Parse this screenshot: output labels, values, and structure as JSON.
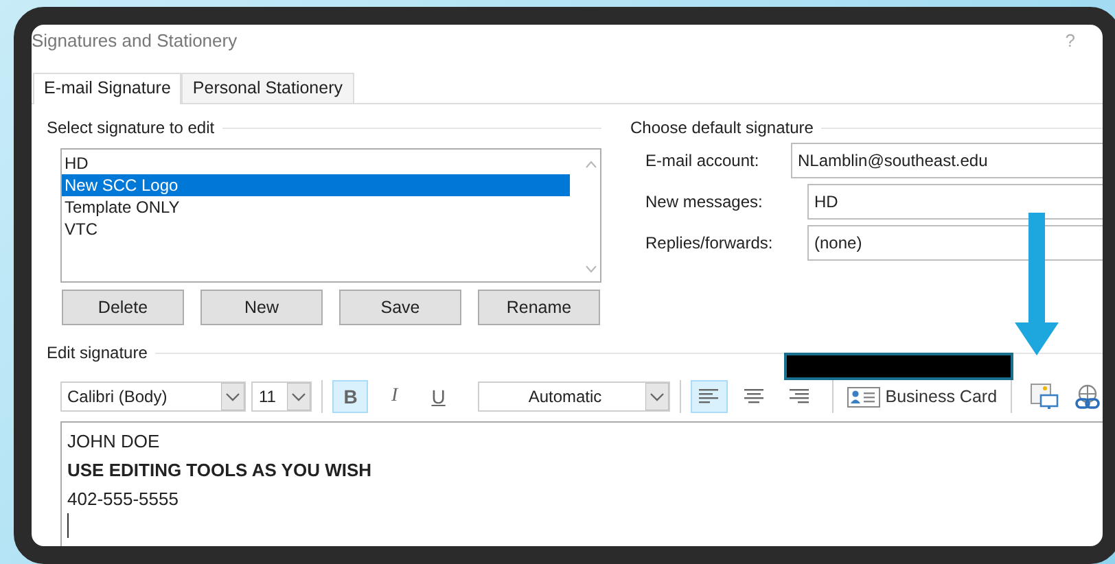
{
  "window": {
    "title": "Signatures and Stationery",
    "help": "?"
  },
  "tabs": [
    {
      "label": "E-mail Signature",
      "selected": true
    },
    {
      "label": "Personal Stationery",
      "selected": false
    }
  ],
  "select_signature": {
    "heading": "Select signature to edit",
    "items": [
      {
        "label": "HD",
        "selected": false
      },
      {
        "label": "New SCC Logo",
        "selected": true
      },
      {
        "label": "Template ONLY",
        "selected": false
      },
      {
        "label": "VTC",
        "selected": false
      }
    ],
    "buttons": [
      "Delete",
      "New",
      "Save",
      "Rename"
    ]
  },
  "default_signature": {
    "heading": "Choose default signature",
    "fields": [
      {
        "label": "E-mail account:",
        "value": "NLamblin@southeast.edu",
        "kind": "account"
      },
      {
        "label": "New messages:",
        "value": "HD",
        "kind": "select"
      },
      {
        "label": "Replies/forwards:",
        "value": "(none)",
        "kind": "select"
      }
    ]
  },
  "edit_signature": {
    "heading": "Edit signature",
    "font": "Calibri (Body)",
    "size": "11",
    "format": [
      {
        "label": "B",
        "kind": "bold",
        "on": true
      },
      {
        "label": "I",
        "kind": "italic",
        "on": false
      },
      {
        "label": "U",
        "kind": "underline",
        "on": false
      }
    ],
    "text_color": "Automatic",
    "align": [
      {
        "kind": "left",
        "selected": true
      },
      {
        "kind": "center",
        "selected": false
      },
      {
        "kind": "right",
        "selected": false
      }
    ],
    "business_card": "Business Card",
    "lines": [
      {
        "text": "JOHN DOE",
        "bold": false
      },
      {
        "text": "USE EDITING TOOLS AS YOU WISH",
        "bold": true
      },
      {
        "text": "402-555-5555",
        "bold": false
      }
    ]
  }
}
